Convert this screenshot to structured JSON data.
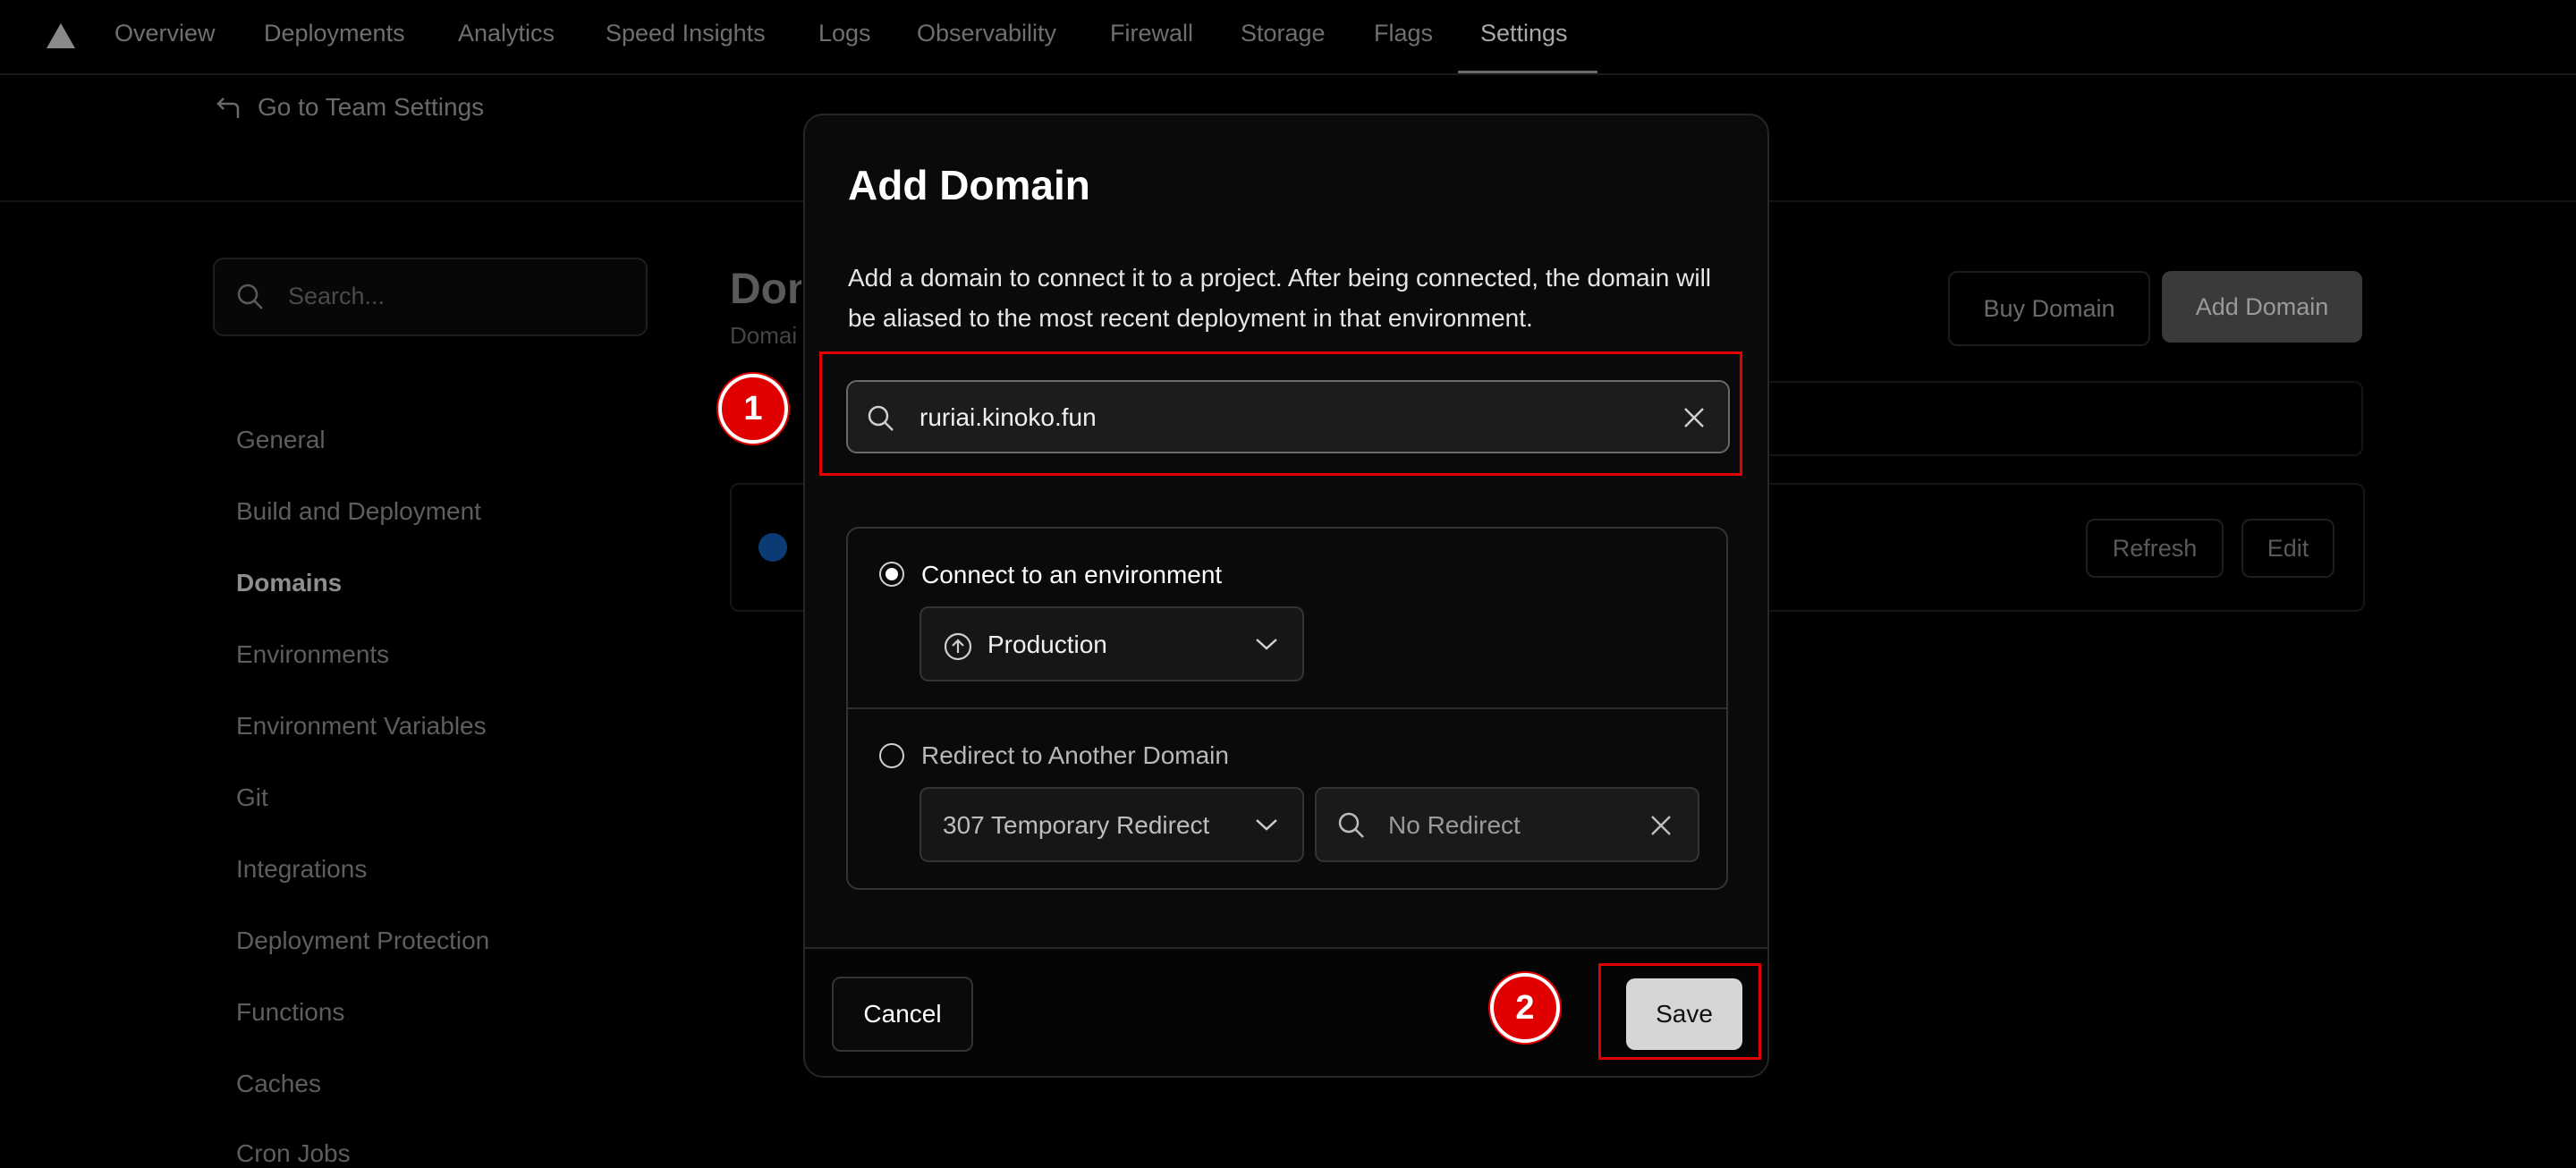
{
  "nav": {
    "tabs": [
      {
        "label": "Overview"
      },
      {
        "label": "Deployments"
      },
      {
        "label": "Analytics"
      },
      {
        "label": "Speed Insights"
      },
      {
        "label": "Logs"
      },
      {
        "label": "Observability"
      },
      {
        "label": "Firewall"
      },
      {
        "label": "Storage"
      },
      {
        "label": "Flags"
      },
      {
        "label": "Settings",
        "active": true
      }
    ],
    "back_link": "Go to Team Settings"
  },
  "sidebar": {
    "search_placeholder": "Search...",
    "items": [
      {
        "label": "General"
      },
      {
        "label": "Build and Deployment"
      },
      {
        "label": "Domains",
        "active": true
      },
      {
        "label": "Environments"
      },
      {
        "label": "Environment Variables"
      },
      {
        "label": "Git"
      },
      {
        "label": "Integrations"
      },
      {
        "label": "Deployment Protection"
      },
      {
        "label": "Functions"
      },
      {
        "label": "Caches"
      },
      {
        "label": "Cron Jobs"
      }
    ]
  },
  "main": {
    "title_partial": "Dom",
    "subtitle_partial": "Domai",
    "buy_domain_label": "Buy Domain",
    "add_domain_label": "Add Domain",
    "refresh_label": "Refresh",
    "edit_label": "Edit"
  },
  "modal": {
    "title": "Add Domain",
    "description": "Add a domain to connect it to a project. After being connected, the domain will be aliased to the most recent deployment in that environment.",
    "domain_value": "ruriai.kinoko.fun",
    "option_connect_label": "Connect to an environment",
    "environment_value": "Production",
    "option_redirect_label": "Redirect to Another Domain",
    "redirect_type_value": "307 Temporary Redirect",
    "redirect_target_placeholder": "No Redirect",
    "cancel_label": "Cancel",
    "save_label": "Save"
  },
  "annotations": {
    "step1": "1",
    "step2": "2",
    "highlight_color": "#e00000"
  },
  "colors": {
    "background": "#000000",
    "modal_bg": "#0a0a0a",
    "save_button_bg": "#d6d6d6"
  }
}
